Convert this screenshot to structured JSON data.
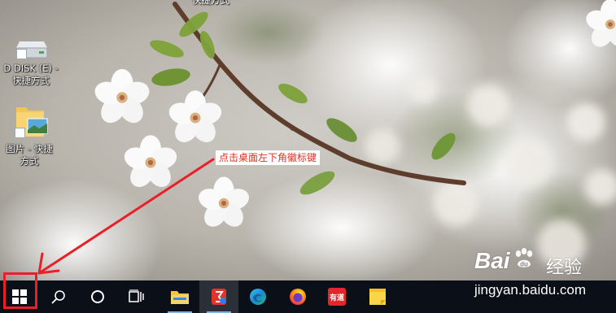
{
  "desktop": {
    "top_partial_label": "快捷方式",
    "icons": [
      {
        "label_line1": "D DISK (E) -",
        "label_line2": "快捷方式",
        "icon": "drive-icon"
      },
      {
        "label_line1": "图片 - 快捷",
        "label_line2": "方式",
        "icon": "pictures-folder-icon"
      }
    ]
  },
  "annotation": {
    "callout_text": "点击桌面左下角徽标键",
    "arrow_color": "#e8202a",
    "highlight_color": "#e8202a"
  },
  "taskbar": {
    "background": "#0b0f17",
    "items": [
      {
        "name": "start-button",
        "icon": "windows-logo-icon"
      },
      {
        "name": "search-button",
        "icon": "search-icon"
      },
      {
        "name": "cortana-button",
        "icon": "cortana-circle-icon"
      },
      {
        "name": "task-view-button",
        "icon": "task-view-icon"
      },
      {
        "name": "file-explorer-app",
        "icon": "folder-icon"
      },
      {
        "name": "pinned-app-active",
        "icon": "red-app-icon"
      },
      {
        "name": "edge-app",
        "icon": "edge-icon"
      },
      {
        "name": "firefox-app",
        "icon": "firefox-icon"
      },
      {
        "name": "youdao-app",
        "icon": "youdao-icon",
        "text": "有道"
      },
      {
        "name": "sticky-notes-app",
        "icon": "sticky-notes-icon"
      }
    ]
  },
  "watermark": {
    "brand": "Bai",
    "brand_suffix": "du",
    "cn_text": "经验",
    "url": "jingyan.baidu.com"
  }
}
